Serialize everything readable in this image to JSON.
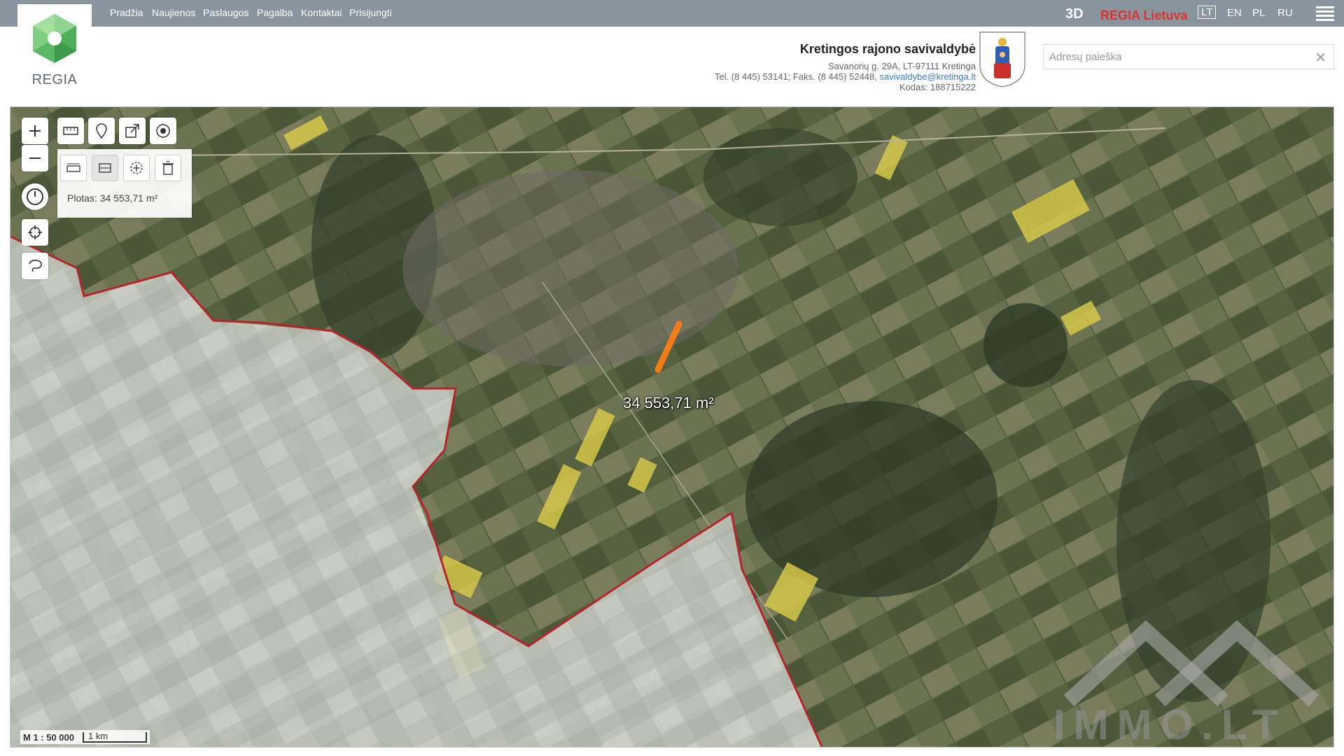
{
  "nav": {
    "links": [
      "Pradžia",
      "Naujienos",
      "Paslaugos",
      "Pagalba",
      "Kontaktai",
      "Prisijungti"
    ]
  },
  "brand": {
    "logo_text": "REGIA"
  },
  "top_right": {
    "btn_3d": "3D",
    "regia_lietuva": "REGIA Lietuva",
    "languages": [
      "LT",
      "EN",
      "PL",
      "RU"
    ],
    "active_language": "LT"
  },
  "municipality": {
    "name": "Kretingos rajono savivaldybė",
    "address": "Savanorių g. 29A, LT-97111 Kretinga",
    "phones": "Tel. (8 445) 53141; Faks. (8 445) 52448,",
    "email": "savivaldybe@kretinga.lt",
    "code": "Kodas: 188715222"
  },
  "search": {
    "placeholder": "Adresų paieška",
    "clear_glyph": "✕"
  },
  "map": {
    "measure_panel_text": "Plotas: 34 553,71 m²",
    "area_label": "34 553,71 m²",
    "scale_ratio": "M 1 : 50 000",
    "scale_distance": "1 km",
    "watermark_text": "IMMO.LT",
    "colors": {
      "municipality_border": "#b3262a",
      "measured_line": "#f07d1a",
      "rapeseed_fields": "#d6c84a"
    }
  },
  "icons": {
    "zoom_in": "plus-icon",
    "zoom_out": "minus-icon",
    "history": "clock-icon",
    "locate": "crosshair-icon",
    "lasso": "lasso-icon",
    "ruler": "ruler-icon",
    "marker": "map-marker-icon",
    "share": "share-icon",
    "radio": "radio-target-icon",
    "measure_distance": "measure-distance-icon",
    "measure_area": "measure-area-icon",
    "pan_select": "pan-select-icon",
    "delete": "trash-icon",
    "menu": "hamburger-icon"
  }
}
